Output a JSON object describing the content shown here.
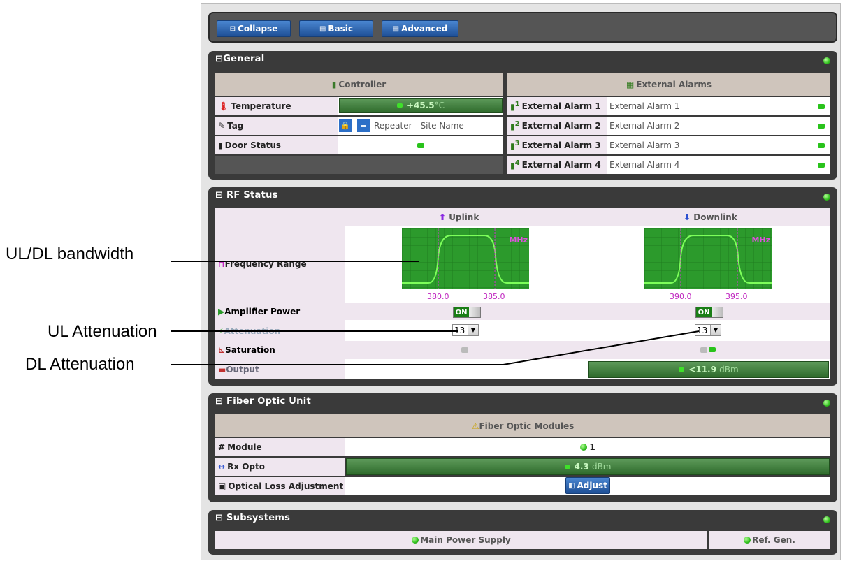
{
  "annotations": {
    "bw": "UL/DL bandwidth",
    "ul": "UL Attenuation",
    "dl": "DL Attenuation"
  },
  "toolbar": {
    "collapse": "Collapse",
    "basic": "Basic",
    "advanced": "Advanced"
  },
  "general": {
    "title": "General",
    "controller_header": "Controller",
    "alarms_header": "External Alarms",
    "rows": [
      {
        "label": "Temperature"
      },
      {
        "label": "Tag"
      },
      {
        "label": "Door Status"
      }
    ],
    "temperature": "+45.5",
    "temperature_unit": "°C",
    "tag_value": "Repeater - Site Name",
    "alarms": [
      {
        "num": "1",
        "label": "External Alarm 1",
        "value": "External Alarm 1"
      },
      {
        "num": "2",
        "label": "External Alarm 2",
        "value": "External Alarm 2"
      },
      {
        "num": "3",
        "label": "External Alarm 3",
        "value": "External Alarm 3"
      },
      {
        "num": "4",
        "label": "External Alarm 4",
        "value": "External Alarm 4"
      }
    ]
  },
  "rf": {
    "title": "RF Status",
    "uplink": "Uplink",
    "downlink": "Downlink",
    "freq_label": "Frequency Range",
    "unit": "MHz",
    "ul_ticks": [
      "380.0",
      "385.0"
    ],
    "dl_ticks": [
      "390.0",
      "395.0"
    ],
    "amp_label": "Amplifier Power",
    "att_label": "Attenuation",
    "sat_label": "Saturation",
    "out_label": "Output",
    "ul_amp": "ON",
    "dl_amp": "ON",
    "ul_att": "13",
    "dl_att": "13",
    "dl_output": "<11.9",
    "dl_output_unit": "dBm"
  },
  "fou": {
    "title": "Fiber Optic Unit",
    "header": "Fiber Optic Modules",
    "module_label": "Module",
    "module_value": "1",
    "rx_label": "Rx Opto",
    "rx_value": "4.3",
    "rx_unit": "dBm",
    "ola_label": "Optical Loss Adjustment",
    "adjust": "Adjust"
  },
  "subsystems": {
    "title": "Subsystems",
    "main_power": "Main Power Supply",
    "ref_gen": "Ref. Gen."
  },
  "colors": {
    "panel": "#3a3a3a",
    "header": "#cfc5bc",
    "label": "#efe6ef",
    "accent": "#2c6fc7",
    "ok": "#2fbf1c"
  }
}
